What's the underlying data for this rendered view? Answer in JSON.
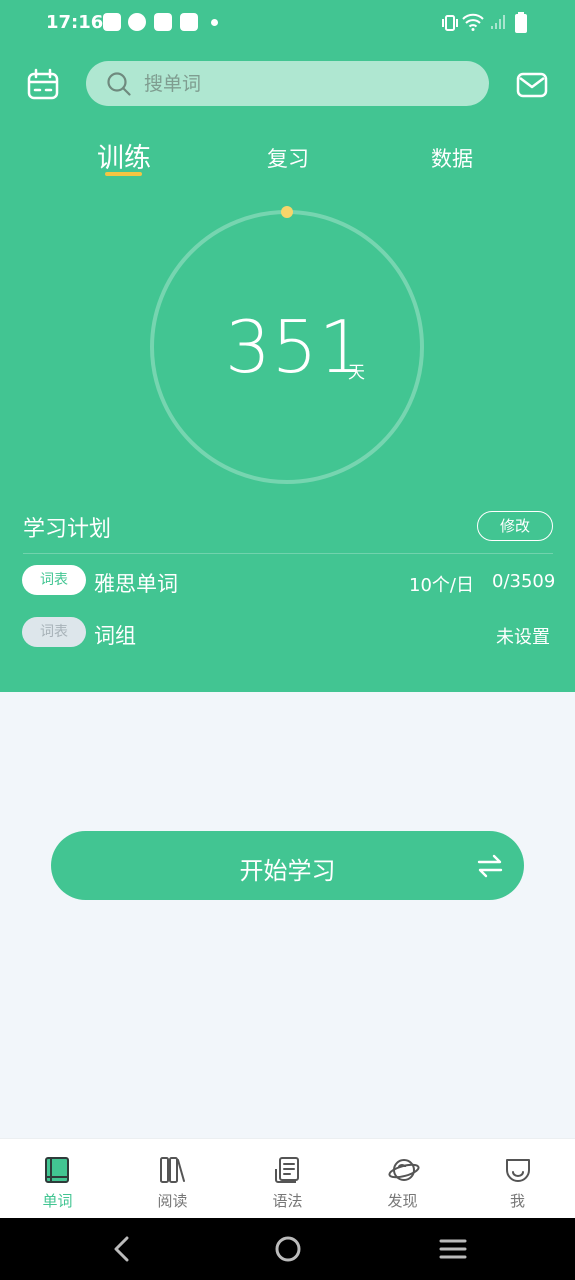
{
  "status_bar": {
    "time": "17:16"
  },
  "header": {
    "search_placeholder": "搜单词"
  },
  "tabs": [
    {
      "label": "训练",
      "active": true
    },
    {
      "label": "复习",
      "active": false
    },
    {
      "label": "数据",
      "active": false
    }
  ],
  "streak": {
    "days": "351",
    "unit": "天"
  },
  "plan": {
    "title": "学习计划",
    "edit_label": "修改",
    "rows": [
      {
        "tag": "词表",
        "name": "雅思单词",
        "rate": "10个/日",
        "progress": "0/3509"
      },
      {
        "tag": "词表",
        "name": "词组",
        "status": "未设置"
      }
    ]
  },
  "start_button": {
    "label": "开始学习"
  },
  "bottom_nav": [
    {
      "label": "单词",
      "icon": "book-icon",
      "active": true
    },
    {
      "label": "阅读",
      "icon": "books-icon",
      "active": false
    },
    {
      "label": "语法",
      "icon": "grammar-icon",
      "active": false
    },
    {
      "label": "发现",
      "icon": "planet-icon",
      "active": false
    },
    {
      "label": "我",
      "icon": "face-icon",
      "active": false
    }
  ],
  "colors": {
    "brand": "#42c592",
    "accent": "#f5c542",
    "background": "#f2f6fa"
  }
}
